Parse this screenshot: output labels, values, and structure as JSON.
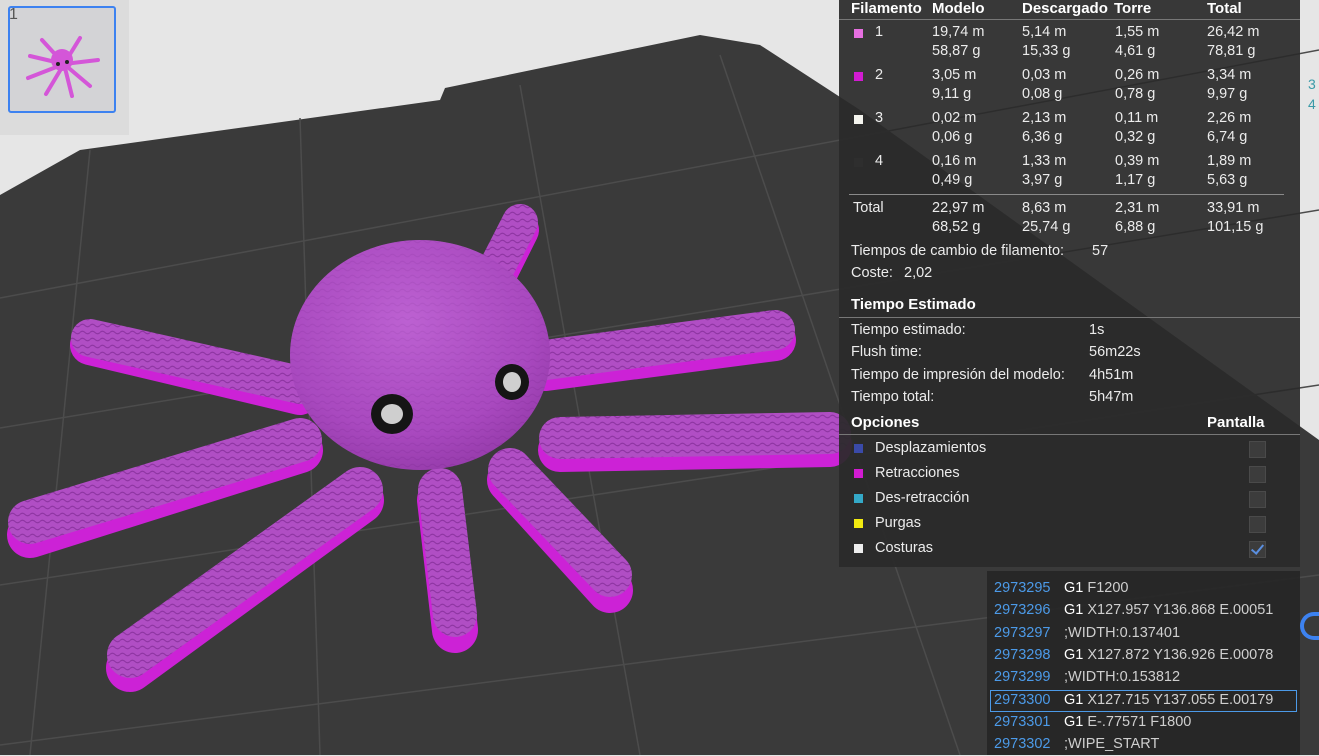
{
  "thumbnail": {
    "index": "1"
  },
  "filament_table": {
    "headers": [
      "Filamento",
      "Modelo",
      "Descargado",
      "Torre",
      "Total"
    ],
    "rows": [
      {
        "id": "1",
        "color": "#e66fe0",
        "modelo": [
          "19,74 m",
          "58,87 g"
        ],
        "descargado": [
          "5,14 m",
          "15,33 g"
        ],
        "torre": [
          "1,55 m",
          "4,61 g"
        ],
        "total": [
          "26,42 m",
          "78,81 g"
        ]
      },
      {
        "id": "2",
        "color": "#d21bd2",
        "modelo": [
          "3,05 m",
          "9,11 g"
        ],
        "descargado": [
          "0,03 m",
          "0,08 g"
        ],
        "torre": [
          "0,26 m",
          "0,78 g"
        ],
        "total": [
          "3,34 m",
          "9,97 g"
        ]
      },
      {
        "id": "3",
        "color": "#f4f4ee",
        "modelo": [
          "0,02 m",
          "0,06 g"
        ],
        "descargado": [
          "2,13 m",
          "6,36 g"
        ],
        "torre": [
          "0,11 m",
          "0,32 g"
        ],
        "total": [
          "2,26 m",
          "6,74 g"
        ]
      },
      {
        "id": "4",
        "color": "#2e2e2e",
        "modelo": [
          "0,16 m",
          "0,49 g"
        ],
        "descargado": [
          "1,33 m",
          "3,97 g"
        ],
        "torre": [
          "0,39 m",
          "1,17 g"
        ],
        "total": [
          "1,89 m",
          "5,63 g"
        ]
      }
    ],
    "total_row": {
      "label": "Total",
      "modelo": [
        "22,97 m",
        "68,52 g"
      ],
      "descargado": [
        "8,63 m",
        "25,74 g"
      ],
      "torre": [
        "2,31 m",
        "6,88 g"
      ],
      "total": [
        "33,91 m",
        "101,15 g"
      ]
    }
  },
  "filament_changes": {
    "label": "Tiempos de cambio de filamento:",
    "value": "57"
  },
  "cost": {
    "label": "Coste:",
    "value": "2,02"
  },
  "time": {
    "title": "Tiempo Estimado",
    "items": [
      {
        "label": "Tiempo estimado:",
        "value": "1s"
      },
      {
        "label": "Flush time:",
        "value": "56m22s"
      },
      {
        "label": "Tiempo de impresión del modelo:",
        "value": "4h51m"
      },
      {
        "label": "Tiempo total:",
        "value": "5h47m"
      }
    ]
  },
  "options": {
    "title": "Opciones",
    "display_label": "Pantalla",
    "items": [
      {
        "label": "Desplazamientos",
        "color": "#3a4aa8",
        "checked": false
      },
      {
        "label": "Retracciones",
        "color": "#d21bd2",
        "checked": false
      },
      {
        "label": "Des-retracción",
        "color": "#34a9c8",
        "checked": false
      },
      {
        "label": "Purgas",
        "color": "#f2ea10",
        "checked": false
      },
      {
        "label": "Costuras",
        "color": "#eeeeee",
        "checked": true
      }
    ]
  },
  "gcode": {
    "lines": [
      {
        "num": "2973295",
        "cmd": "G1",
        "args": "F1200"
      },
      {
        "num": "2973296",
        "cmd": "G1",
        "args": "X127.957 Y136.868 E.00051"
      },
      {
        "num": "2973297",
        "cmd": "",
        "args": ";WIDTH:0.137401"
      },
      {
        "num": "2973298",
        "cmd": "G1",
        "args": "X127.872 Y136.926 E.00078"
      },
      {
        "num": "2973299",
        "cmd": "",
        "args": ";WIDTH:0.153812"
      },
      {
        "num": "2973300",
        "cmd": "G1",
        "args": "X127.715 Y137.055 E.00179",
        "selected": true
      },
      {
        "num": "2973301",
        "cmd": "G1",
        "args": "E-.77571 F1800"
      },
      {
        "num": "2973302",
        "cmd": "",
        "args": ";WIPE_START"
      }
    ]
  },
  "edge_glyphs": [
    "3",
    "4"
  ]
}
